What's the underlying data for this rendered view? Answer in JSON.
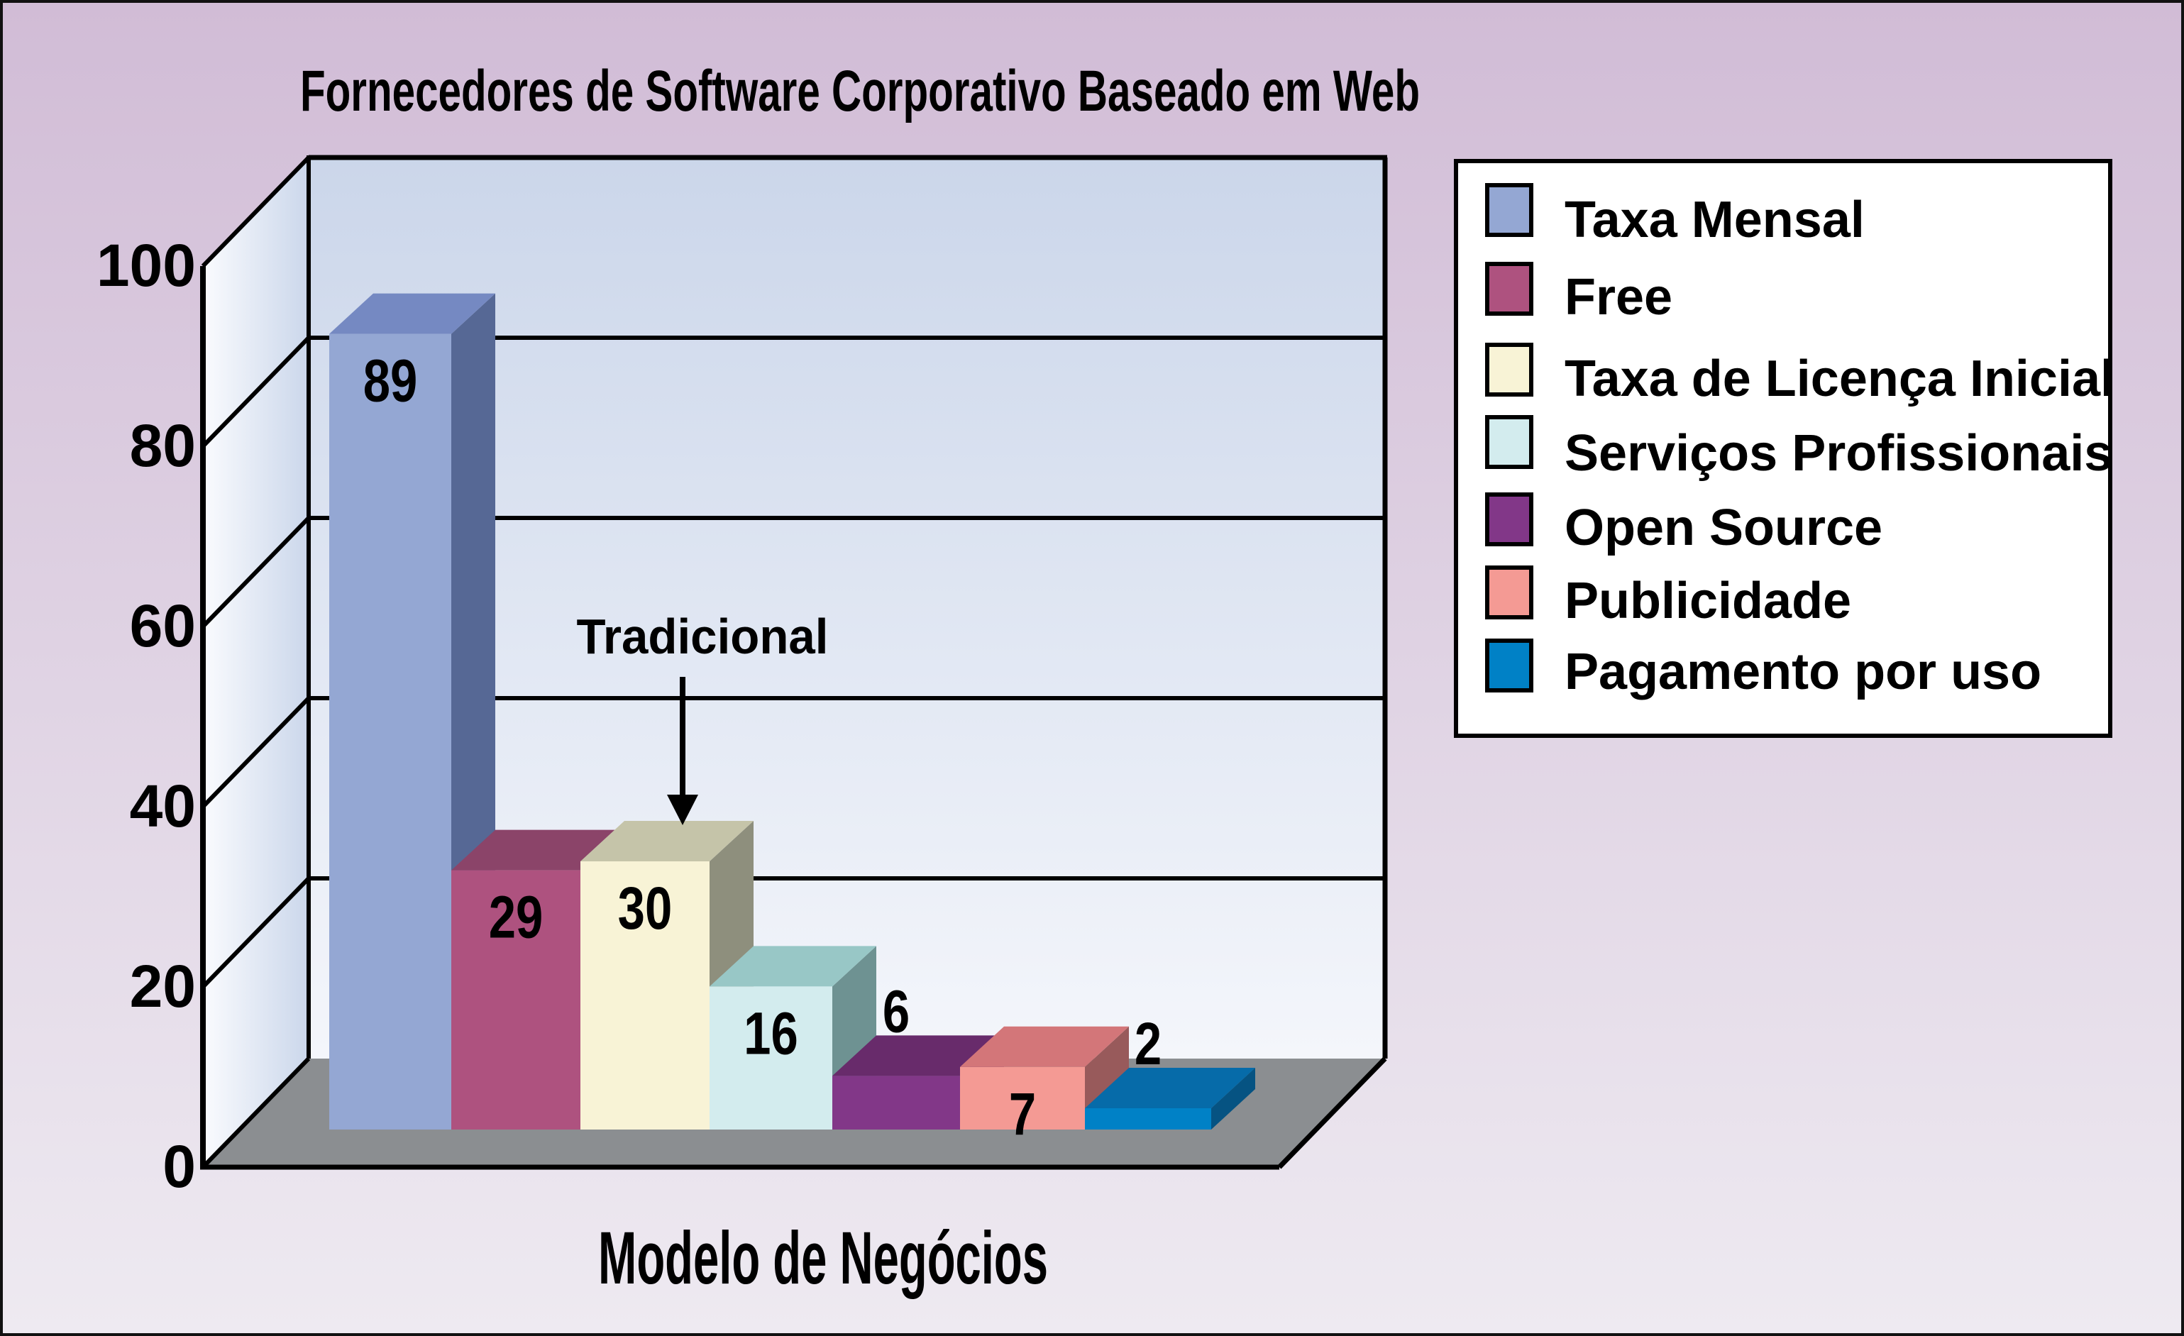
{
  "chart_data": {
    "type": "bar",
    "title": "Fornecedores de Software Corporativo Baseado em Web",
    "xlabel": "Modelo de Negócios",
    "ylabel": "",
    "ylim": [
      0,
      100
    ],
    "yticks": [
      0,
      20,
      40,
      60,
      80,
      100
    ],
    "ytick_labels": [
      "0",
      "20",
      "40",
      "60",
      "80",
      "100"
    ],
    "grid": true,
    "style": "3d",
    "categories": [
      "Taxa Mensal",
      "Free",
      "Taxa de Licença Inicial",
      "Serviços Profissionais",
      "Open Source",
      "Publicidade",
      "Pagamento por uso"
    ],
    "values": [
      89,
      29,
      30,
      16,
      6,
      7,
      2
    ],
    "data_labels": [
      "89",
      "29",
      "30",
      "16",
      "6",
      "7",
      "2"
    ],
    "colors": [
      "#94A7D3",
      "#AE527F",
      "#F8F3D6",
      "#D3ECEE",
      "#823788",
      "#F49A94",
      "#0081C6"
    ],
    "top_colors": [
      "#7589C2",
      "#8B4469",
      "#C5C4A9",
      "#98C7C6",
      "#682B6B",
      "#D37679",
      "#066BA9"
    ],
    "side_colors": [
      "#566895",
      "#6F3553",
      "#8E8F7D",
      "#6E9292",
      "#4F2052",
      "#985A5B",
      "#065382"
    ],
    "legend": {
      "position": "right",
      "entries": [
        "Taxa Mensal",
        "Free",
        "Taxa de Licença Inicial",
        "Serviços Profissionais",
        "Open Source",
        "Publicidade",
        "Pagamento por uso"
      ]
    },
    "annotations": [
      {
        "text": "Tradicional",
        "target_category": "Taxa de Licença Inicial",
        "arrow": "down"
      }
    ]
  },
  "colors": {
    "background_top": "#D1BCD6",
    "background_bottom": "#EEEAF1",
    "wall_top": "#CBD6EA",
    "wall_bottom": "#F4F6FB",
    "floor": "#8B8E91"
  }
}
